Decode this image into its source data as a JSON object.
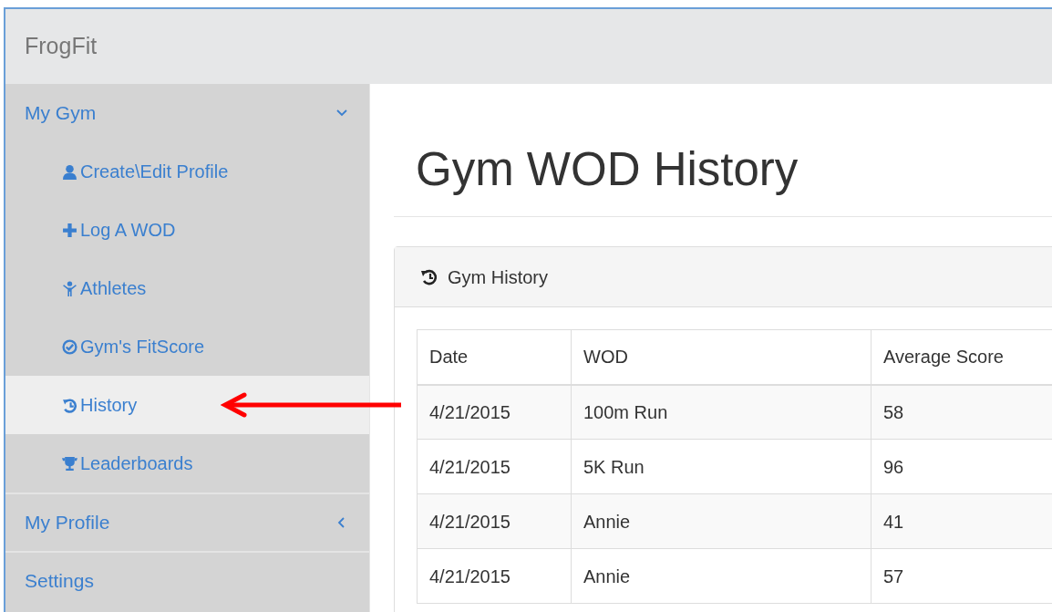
{
  "app": {
    "title": "FrogFit"
  },
  "sidebar": {
    "items": [
      {
        "label": "My Gym",
        "expanded": true,
        "children": [
          {
            "label": "Create\\Edit Profile",
            "selected": false
          },
          {
            "label": "Log A WOD",
            "selected": false
          },
          {
            "label": "Athletes",
            "selected": false
          },
          {
            "label": "Gym's FitScore",
            "selected": false
          },
          {
            "label": "History",
            "selected": true
          },
          {
            "label": "Leaderboards",
            "selected": false
          }
        ]
      },
      {
        "label": "My Profile",
        "expanded": false
      },
      {
        "label": "Settings"
      }
    ]
  },
  "page": {
    "heading": "Gym WOD History",
    "panel": {
      "title": "Gym History",
      "table": {
        "columns": [
          "Date",
          "WOD",
          "Average Score"
        ],
        "rows": [
          [
            "4/21/2015",
            "100m Run",
            "58"
          ],
          [
            "4/21/2015",
            "5K Run",
            "96"
          ],
          [
            "4/21/2015",
            "Annie",
            "41"
          ],
          [
            "4/21/2015",
            "Annie",
            "57"
          ]
        ]
      }
    }
  }
}
